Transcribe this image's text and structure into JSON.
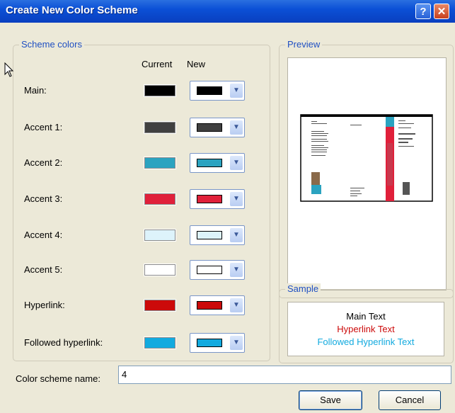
{
  "window": {
    "title": "Create New Color Scheme",
    "help_label": "?",
    "close_label": "✕"
  },
  "scheme": {
    "legend": "Scheme colors",
    "col_current": "Current",
    "col_new": "New",
    "rows": [
      {
        "label": "Main:",
        "current": "#000000",
        "new": "#000000"
      },
      {
        "label": "Accent 1:",
        "current": "#404040",
        "new": "#404040"
      },
      {
        "label": "Accent 2:",
        "current": "#2ba3c0",
        "new": "#2ba3c0"
      },
      {
        "label": "Accent 3:",
        "current": "#e0203a",
        "new": "#e0203a"
      },
      {
        "label": "Accent 4:",
        "current": "#ddf3fb",
        "new": "#ddf3fb"
      },
      {
        "label": "Accent 5:",
        "current": "#ffffff",
        "new": "#ffffff"
      },
      {
        "label": "Hyperlink:",
        "current": "#cc0a0a",
        "new": "#cc0a0a"
      },
      {
        "label": "Followed hyperlink:",
        "current": "#12aadf",
        "new": "#12aadf"
      }
    ]
  },
  "preview": {
    "legend": "Preview"
  },
  "sample": {
    "legend": "Sample",
    "main_text": "Main Text",
    "hyperlink_text": "Hyperlink Text",
    "followed_text": "Followed Hyperlink Text",
    "main_color": "#000000",
    "hyperlink_color": "#cc0a0a",
    "followed_color": "#12aadf"
  },
  "name_field": {
    "label": "Color scheme name:",
    "value": "4"
  },
  "buttons": {
    "save": "Save",
    "cancel": "Cancel"
  }
}
